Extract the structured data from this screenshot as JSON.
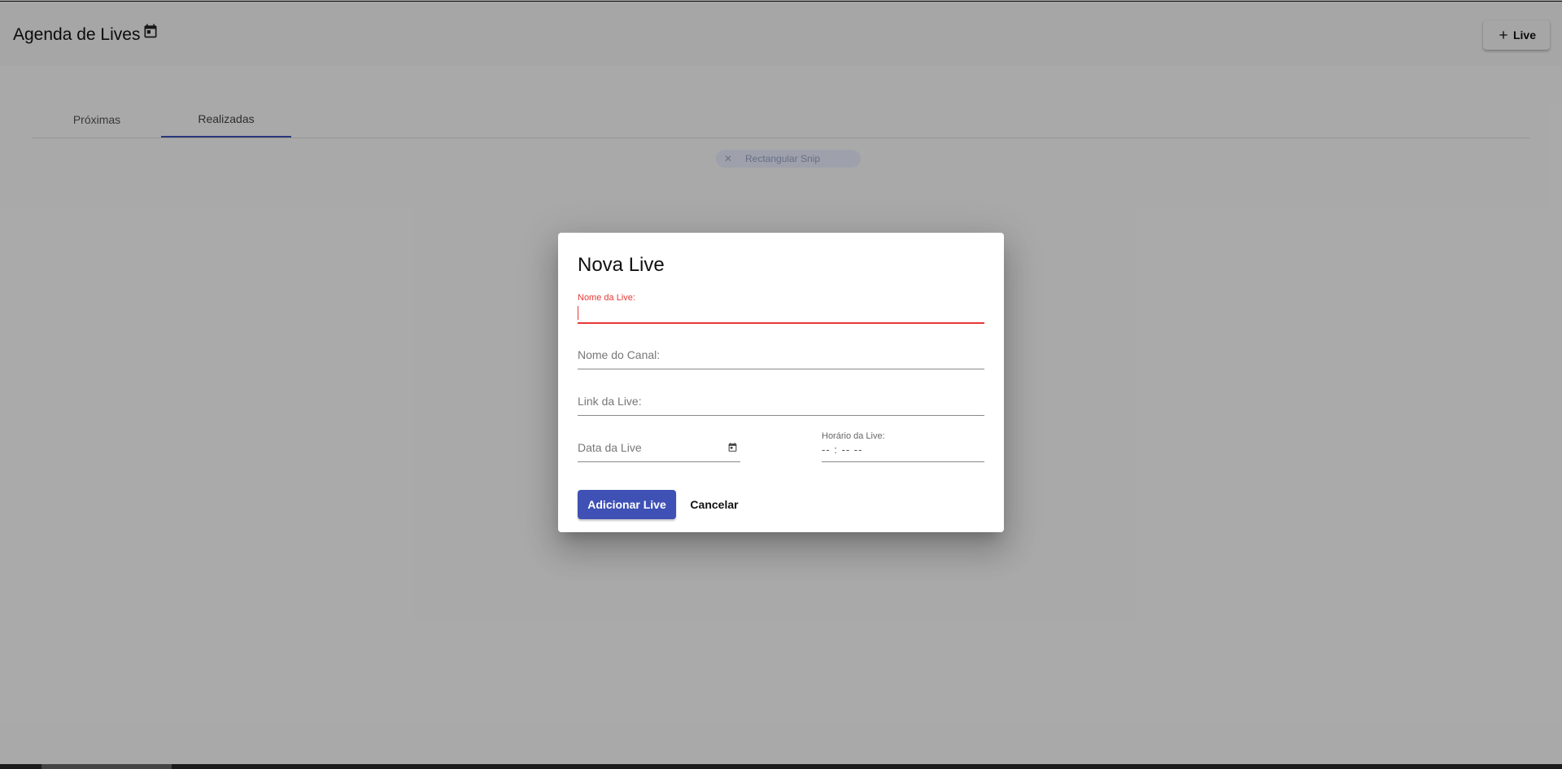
{
  "app": {
    "title": "Agenda de Lives",
    "title_icon": "calendar-icon",
    "add_button_label": "Live",
    "add_button_icon": "plus-icon"
  },
  "tabs": [
    {
      "label": "Próximas",
      "active": false
    },
    {
      "label": "Realizadas",
      "active": true
    }
  ],
  "snip_overlay": {
    "label": "Rectangular Snip",
    "icon": "close-icon"
  },
  "dialog": {
    "title": "Nova Live",
    "fields": {
      "nome_live": {
        "label": "Nome da Live:",
        "value": "",
        "state": "focused-invalid"
      },
      "nome_canal": {
        "placeholder": "Nome do Canal:",
        "value": ""
      },
      "link_live": {
        "placeholder": "Link da Live:",
        "value": ""
      },
      "data_live": {
        "placeholder": "Data da Live",
        "value": "",
        "icon": "calendar-icon"
      },
      "horario_live": {
        "label": "Horário da Live:",
        "value": "-- : --   --"
      }
    },
    "buttons": {
      "submit": "Adicionar Live",
      "cancel": "Cancelar"
    }
  },
  "colors": {
    "primary": "#3f51b5",
    "error": "#e53935"
  }
}
